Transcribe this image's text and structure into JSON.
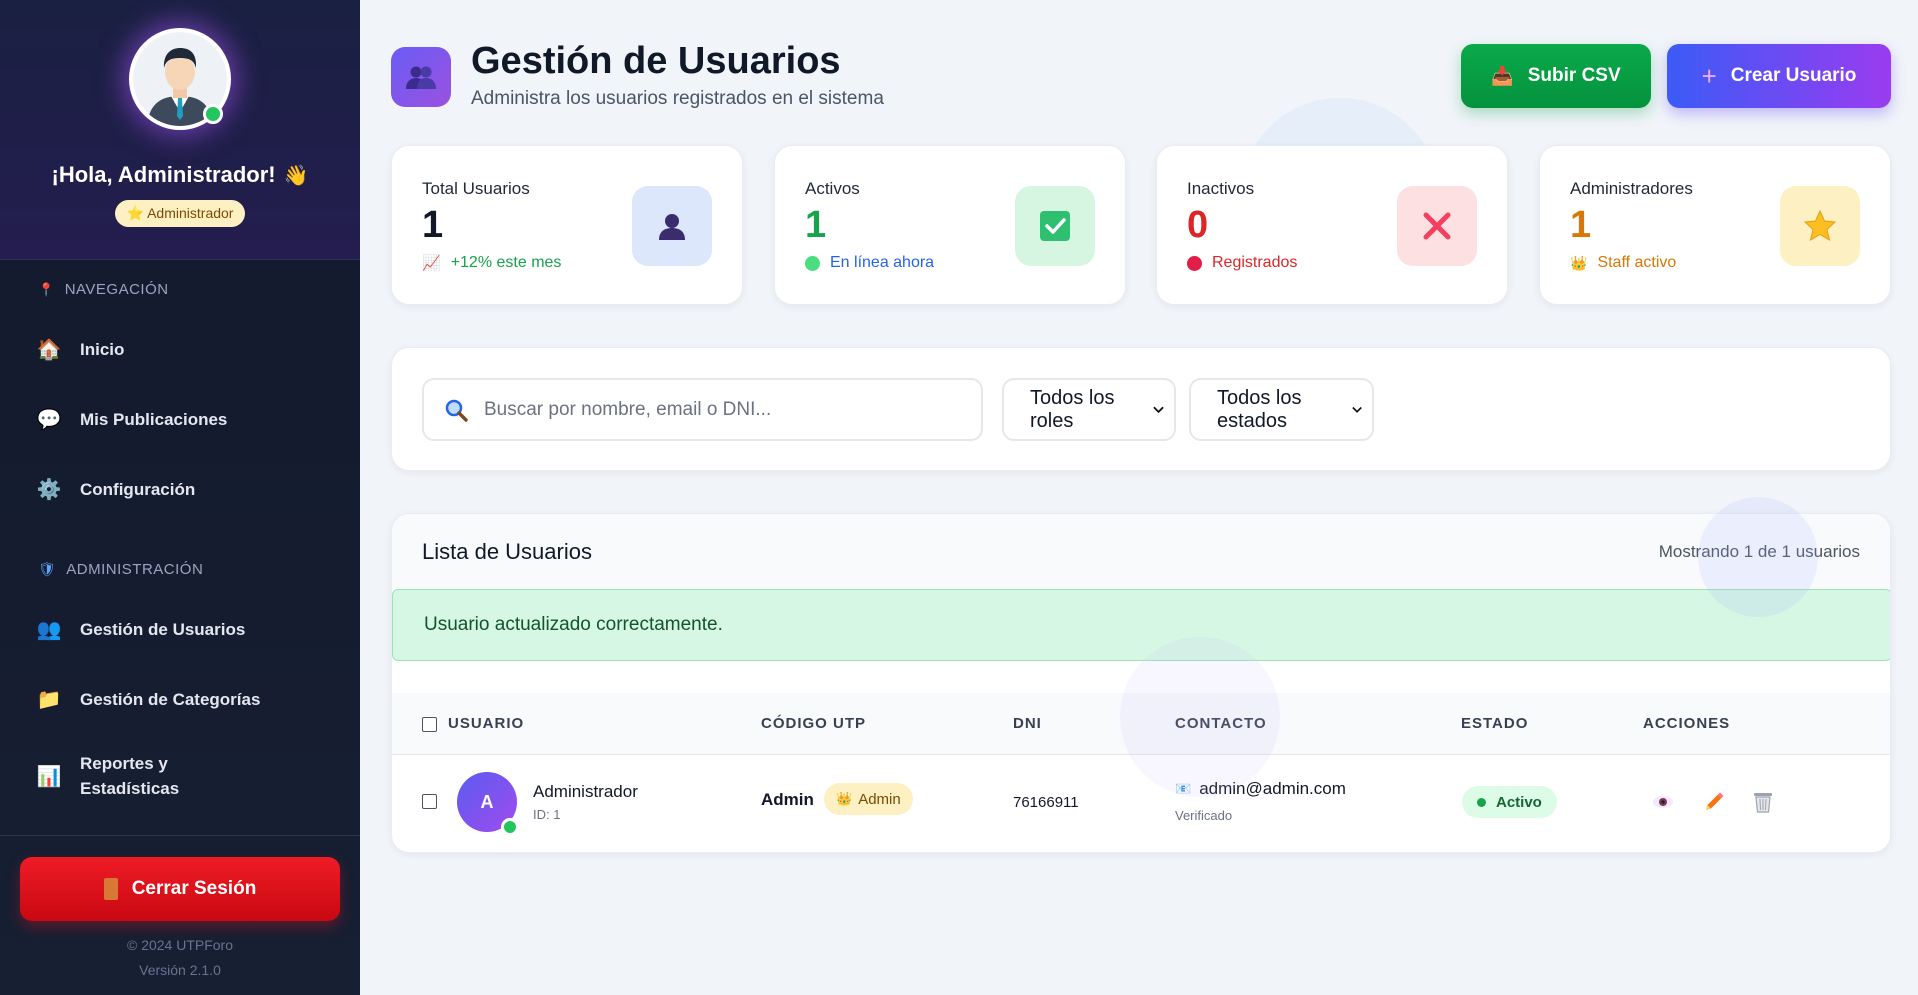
{
  "sidebar": {
    "greeting": "¡Hola, Administrador!",
    "role": "Administrador",
    "section_nav": "NAVEGACIÓN",
    "section_admin": "ADMINISTRACIÓN",
    "nav_items": [
      {
        "label": "Inicio",
        "icon": "house-icon"
      },
      {
        "label": "Mis Publicaciones",
        "icon": "speech-bubble-icon"
      },
      {
        "label": "Configuración",
        "icon": "gear-icon"
      }
    ],
    "admin_items": [
      {
        "label": "Gestión de Usuarios",
        "icon": "users-icon"
      },
      {
        "label": "Gestión de Categorías",
        "icon": "folder-icon"
      },
      {
        "label_line1": "Reportes y",
        "label_line2": "Estadísticas",
        "icon": "bar-chart-icon"
      }
    ],
    "logout_label": "Cerrar Sesión",
    "copyright": "© 2024 UTPForo",
    "version": "Versión 2.1.0"
  },
  "header": {
    "title": "Gestión de Usuarios",
    "subtitle": "Administra los usuarios registrados en el sistema",
    "upload_csv_label": "Subir CSV",
    "create_user_label": "Crear Usuario"
  },
  "stats": [
    {
      "label": "Total Usuarios",
      "value": "1",
      "foot": "+12% este mes",
      "value_color": "#111827",
      "foot_color": "#16a34a",
      "icon": "user-icon",
      "icon_bg": "#dde7fb"
    },
    {
      "label": "Activos",
      "value": "1",
      "foot": "En línea ahora",
      "value_color": "#16a34a",
      "foot_color": "#2563eb",
      "icon": "check-box-icon",
      "icon_bg": "#d7f6e2"
    },
    {
      "label": "Inactivos",
      "value": "0",
      "foot": "Registrados",
      "value_color": "#dc2626",
      "foot_color": "#dc2626",
      "icon": "cross-icon",
      "icon_bg": "#fde0e2"
    },
    {
      "label": "Administradores",
      "value": "1",
      "foot": "Staff activo",
      "value_color": "#d97706",
      "foot_color": "#d97706",
      "icon": "star-icon",
      "icon_bg": "#fdf0c2"
    }
  ],
  "filters": {
    "search_placeholder": "Buscar por nombre, email o DNI...",
    "role_selected": "Todos los roles",
    "status_selected": "Todos los estados"
  },
  "list": {
    "title": "Lista de Usuarios",
    "count_text": "Mostrando 1 de 1 usuarios",
    "alert": "Usuario actualizado correctamente.",
    "columns": [
      "USUARIO",
      "CÓDIGO UTP",
      "DNI",
      "CONTACTO",
      "ESTADO",
      "ACCIONES"
    ],
    "rows": [
      {
        "initial": "A",
        "name": "Administrador",
        "id_text": "ID: 1",
        "code": "Admin",
        "role_badge": "Admin",
        "dni": "76166911",
        "email": "admin@admin.com",
        "email_status": "Verificado",
        "status": "Activo"
      }
    ]
  },
  "colors": {
    "accent_purple": "#7c3aed",
    "success_green": "#16a34a",
    "danger_red": "#dc2626",
    "warning_amber": "#d97706"
  }
}
